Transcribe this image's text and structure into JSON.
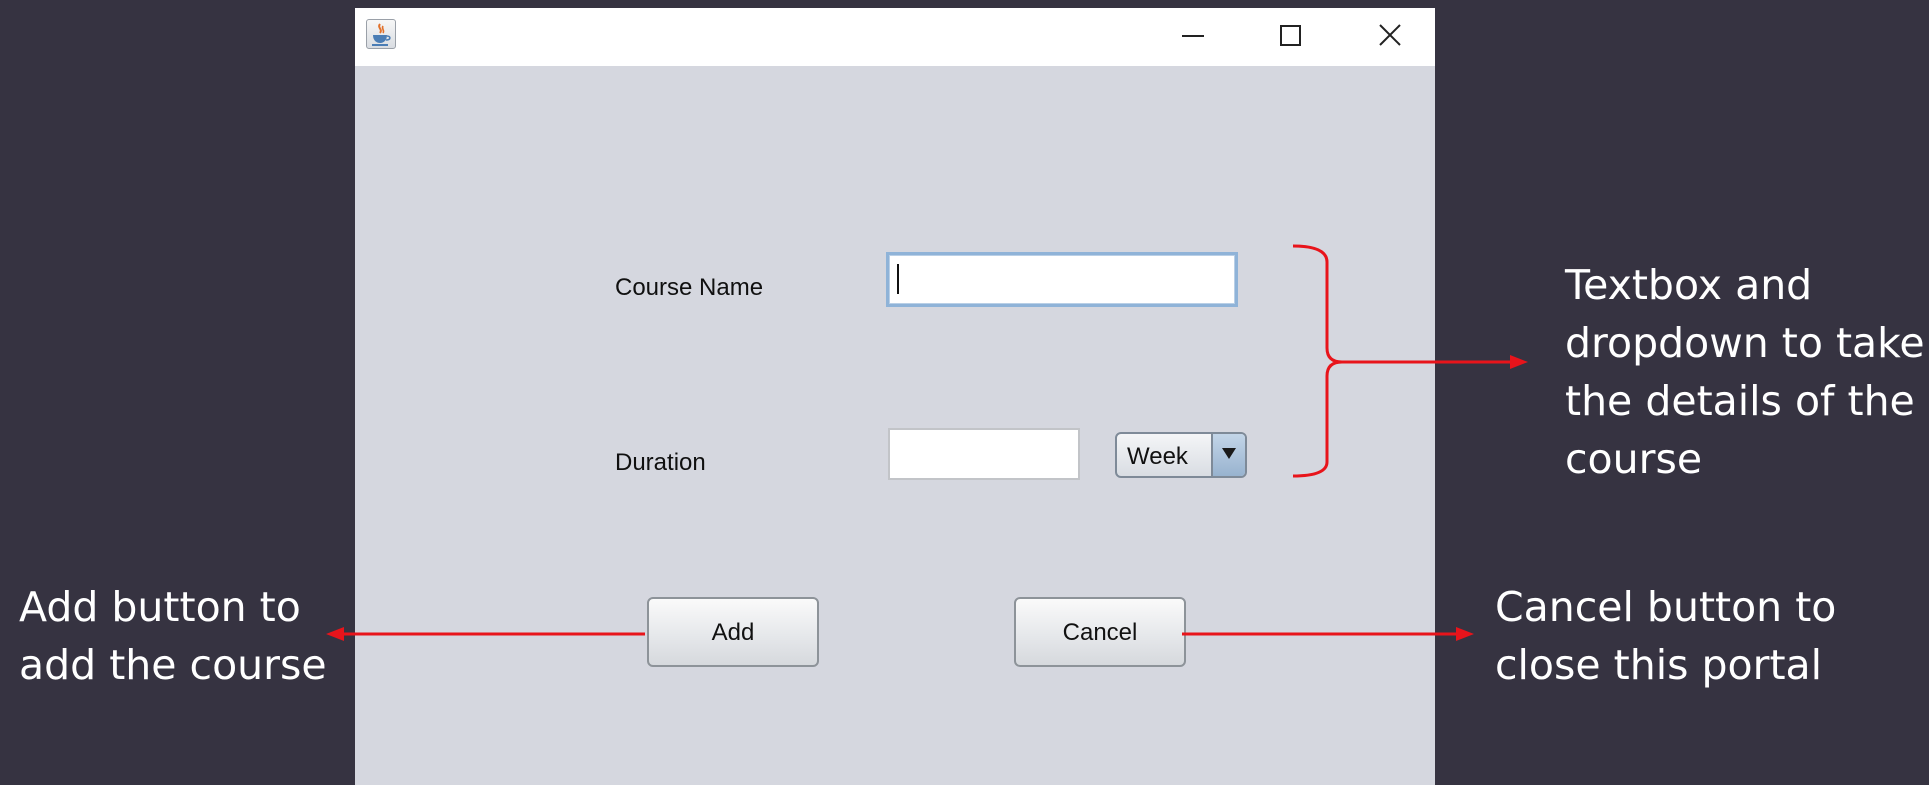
{
  "window": {
    "title": "",
    "controls": {
      "minimize_icon": "minimize-icon",
      "maximize_icon": "maximize-icon",
      "close_icon": "close-icon"
    },
    "app_icon": "java-icon"
  },
  "form": {
    "course_name_label": "Course Name",
    "course_name_value": "",
    "duration_label": "Duration",
    "duration_value": "",
    "duration_unit": "Week",
    "add_label": "Add",
    "cancel_label": "Cancel"
  },
  "annotations": {
    "fields_note": [
      "Textbox and",
      "dropdown to take",
      "the details of the",
      "course"
    ],
    "add_note": [
      "Add button to",
      "add the course"
    ],
    "cancel_note": [
      "Cancel button to",
      "close this portal"
    ]
  },
  "colors": {
    "background": "#363341",
    "window_body": "#d5d7df",
    "annotation_line": "#e8141b",
    "annotation_text": "#ffffff",
    "focus_border": "#8fb3d8"
  }
}
